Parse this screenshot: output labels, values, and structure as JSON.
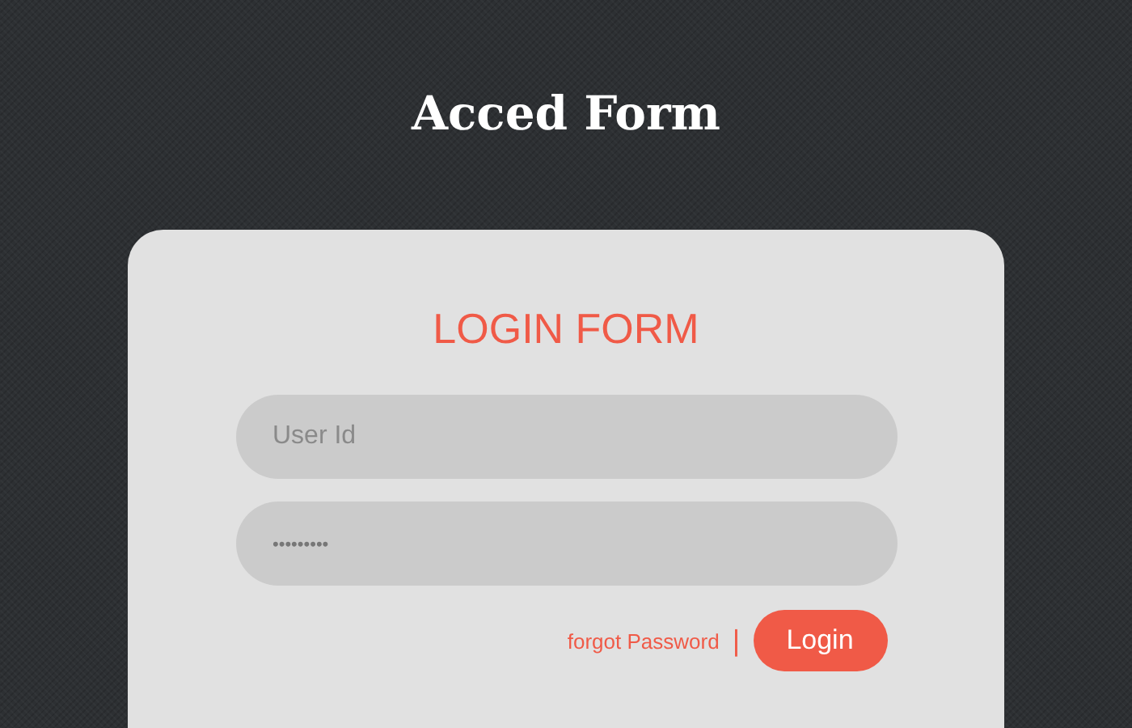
{
  "page": {
    "title": "Acced Form"
  },
  "login_form": {
    "heading": "LOGIN FORM",
    "fields": [
      {
        "placeholder": "User Id",
        "kind": "text"
      },
      {
        "placeholder": "•••••••••",
        "kind": "password"
      }
    ],
    "forgot_link": "forgot Password",
    "separator": "|",
    "submit_button": "Login"
  }
}
